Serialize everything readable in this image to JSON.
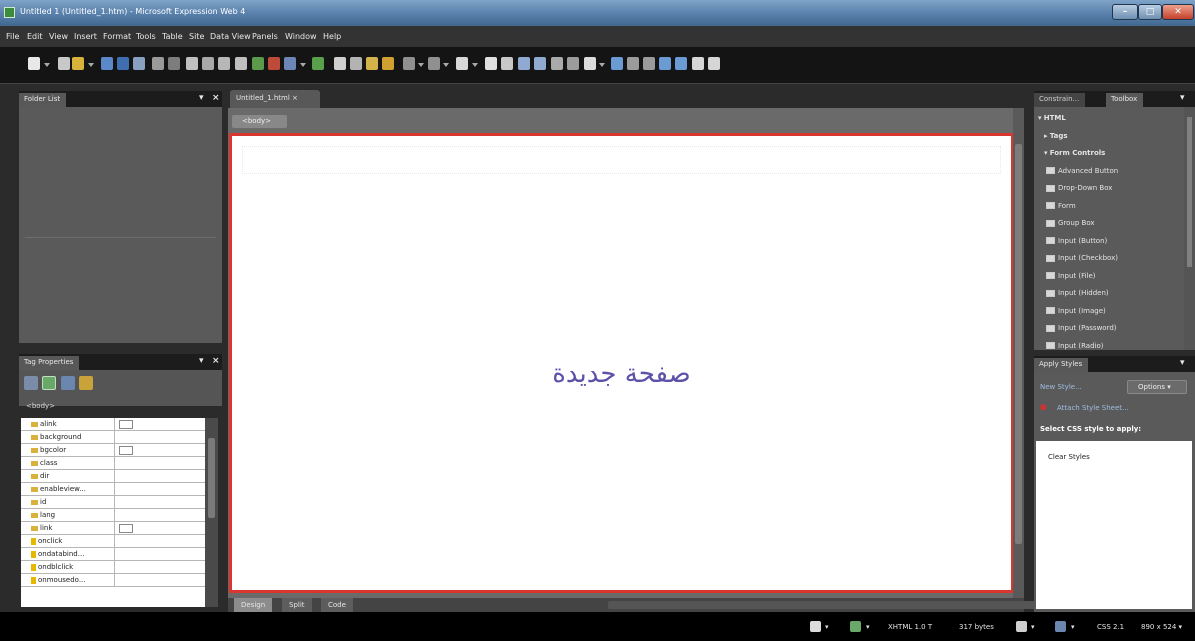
{
  "window": {
    "title": "Untitled 1 (Untitled_1.htm) - Microsoft Expression Web 4",
    "min_glyph": "–",
    "max_glyph": "□",
    "close_glyph": "✕"
  },
  "menu": [
    "File",
    "Edit",
    "View",
    "Insert",
    "Format",
    "Tools",
    "Table",
    "Site",
    "Data View",
    "Panels",
    "Window",
    "Help"
  ],
  "toolbar_icons": [
    "new-page-icon",
    "open-icon",
    "save-icon",
    "publish-icon",
    "preview-icon",
    "spelling-icon",
    "cut-icon",
    "copy-icon",
    "paste-icon",
    "format-painter-icon",
    "undo-icon",
    "redo-icon",
    "layer-icon",
    "image-icon",
    "table-icon",
    "hyperlink-icon",
    "align-icon",
    "zoom-icon"
  ],
  "panels": {
    "folder_list": {
      "title": "Folder List",
      "pin_glyph": "▾",
      "close_glyph": "×"
    },
    "tag_properties": {
      "title": "Tag Properties",
      "pin_glyph": "▾",
      "close_glyph": "×",
      "current_tag": "<body>",
      "rows": [
        {
          "name": "alink",
          "swatch": true
        },
        {
          "name": "background",
          "swatch": false
        },
        {
          "name": "bgcolor",
          "swatch": true
        },
        {
          "name": "class",
          "swatch": false
        },
        {
          "name": "dir",
          "swatch": false
        },
        {
          "name": "enableview...",
          "swatch": false
        },
        {
          "name": "id",
          "swatch": false
        },
        {
          "name": "lang",
          "swatch": false
        },
        {
          "name": "link",
          "swatch": true
        },
        {
          "name": "onclick",
          "swatch": false
        },
        {
          "name": "ondatabind...",
          "swatch": false
        },
        {
          "name": "ondblclick",
          "swatch": false
        },
        {
          "name": "onmousedo...",
          "swatch": false
        }
      ]
    },
    "toolbox": {
      "tabs": [
        "Constrain...",
        "Toolbox"
      ],
      "pin_glyph": "▾",
      "items": [
        {
          "label": "HTML",
          "level": 0,
          "expander": "▾"
        },
        {
          "label": "Tags",
          "level": 1,
          "expander": "▸"
        },
        {
          "label": "Form Controls",
          "level": 1,
          "expander": "▾"
        },
        {
          "label": "Advanced Button",
          "level": 2
        },
        {
          "label": "Drop-Down Box",
          "level": 2
        },
        {
          "label": "Form",
          "level": 2
        },
        {
          "label": "Group Box",
          "level": 2
        },
        {
          "label": "Input (Button)",
          "level": 2
        },
        {
          "label": "Input (Checkbox)",
          "level": 2
        },
        {
          "label": "Input (File)",
          "level": 2
        },
        {
          "label": "Input (Hidden)",
          "level": 2
        },
        {
          "label": "Input (Image)",
          "level": 2
        },
        {
          "label": "Input (Password)",
          "level": 2
        },
        {
          "label": "Input (Radio)",
          "level": 2
        }
      ]
    },
    "apply_styles": {
      "title": "Apply Styles",
      "pin_glyph": "▾",
      "new_style": "New Style...",
      "options": "Options ▾",
      "attach": "Attach Style Sheet...",
      "select_label": "Select CSS style to apply:",
      "list": [
        "Clear Styles"
      ]
    }
  },
  "document": {
    "tab_label": "Untitled_1.html ×",
    "tag_crumb": "<body>",
    "canvas_text": "صفحة جديدة",
    "view_tabs": [
      "Design",
      "Split",
      "Code"
    ],
    "active_view": "Design"
  },
  "statusbar": {
    "doctype": "XHTML 1.0 T",
    "size": "317 bytes",
    "css": "CSS 2.1",
    "dimensions": "890 x 524 ▾"
  },
  "colors": {
    "canvas_border": "#d9372e",
    "canvas_text": "#5b51a8"
  }
}
